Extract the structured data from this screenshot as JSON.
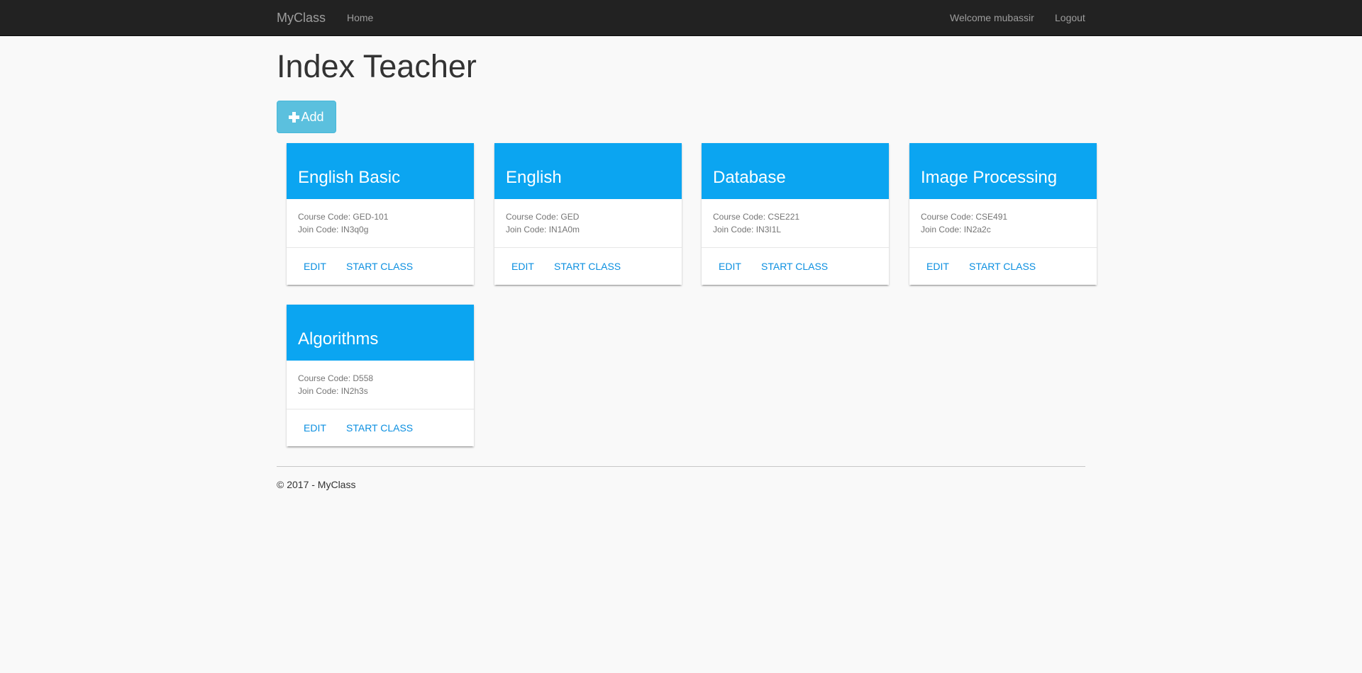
{
  "navbar": {
    "brand": "MyClass",
    "home": "Home",
    "welcome": "Welcome mubassir",
    "logout": "Logout"
  },
  "page": {
    "title": "Index Teacher",
    "add_label": "Add"
  },
  "labels": {
    "course_code": "Course Code: ",
    "join_code": "Join Code: ",
    "edit": "EDIT",
    "start": "START CLASS"
  },
  "courses": [
    {
      "name": "English Basic",
      "course_code": "GED-101",
      "join_code": "IN3q0g"
    },
    {
      "name": "English",
      "course_code": "GED",
      "join_code": "IN1A0m"
    },
    {
      "name": "Database",
      "course_code": "CSE221",
      "join_code": "IN3I1L"
    },
    {
      "name": "Image Processing",
      "course_code": "CSE491",
      "join_code": "IN2a2c"
    },
    {
      "name": "Algorithms",
      "course_code": "D558",
      "join_code": "IN2h3s"
    }
  ],
  "footer": {
    "text": "© 2017 - MyClass"
  },
  "colors": {
    "navbar_bg": "#222222",
    "card_header": "#0ba5f1",
    "link": "#0b8fe0",
    "add_button": "#5bc0de"
  }
}
